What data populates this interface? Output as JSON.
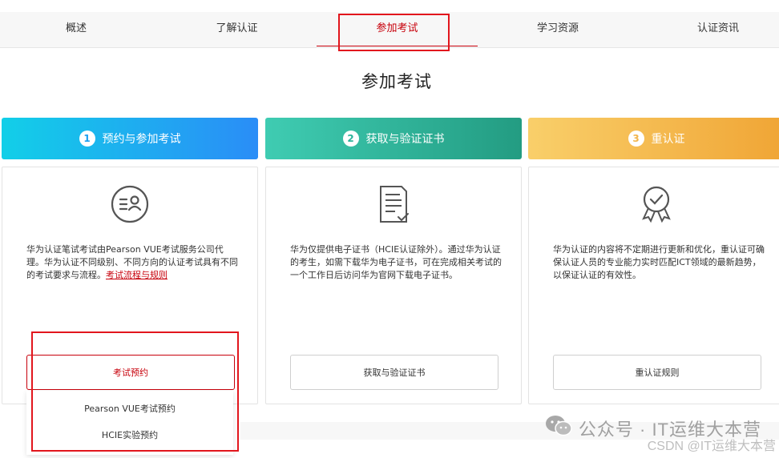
{
  "nav": {
    "tabs": [
      {
        "label": "概述"
      },
      {
        "label": "了解认证"
      },
      {
        "label": "参加考试"
      },
      {
        "label": "学习资源"
      },
      {
        "label": "认证资讯"
      }
    ],
    "active_index": 2
  },
  "page_title": "参加考试",
  "steps": [
    {
      "num": "1",
      "title": "预约与参加考试",
      "icon": "certificate-person-icon",
      "desc": "华为认证笔试考试由Pearson VUE考试服务公司代理。华为认证不同级别、不同方向的认证考试具有不同的考试要求与流程。",
      "link": "考试流程与规则",
      "button": "考试预约"
    },
    {
      "num": "2",
      "title": "获取与验证证书",
      "icon": "document-check-icon",
      "desc": "华为仅提供电子证书（HCIE认证除外）。通过华为认证的考生，如需下载华为电子证书，可在完成相关考试的一个工作日后访问华为官网下载电子证书。",
      "button": "获取与验证证书"
    },
    {
      "num": "3",
      "title": "重认证",
      "icon": "award-badge-icon",
      "desc": "华为认证的内容将不定期进行更新和优化，重认证可确保认证人员的专业能力实时匹配ICT领域的最新趋势，以保证认证的有效性。",
      "button": "重认证规则"
    }
  ],
  "dropdown": {
    "options": [
      "Pearson VUE考试预约",
      "HCIE实验预约"
    ]
  },
  "watermark": {
    "text": "公众号 · IT运维大本营",
    "csdn": "CSDN @IT运维大本营"
  },
  "colors": {
    "accent": "#c7000b",
    "highlight": "#e2161d",
    "step1_start": "#12cfe8",
    "step1_end": "#2a8df7",
    "step2_start": "#3fccb2",
    "step2_end": "#239c82",
    "step3_start": "#f9cf6a",
    "step3_end": "#f0a535"
  }
}
